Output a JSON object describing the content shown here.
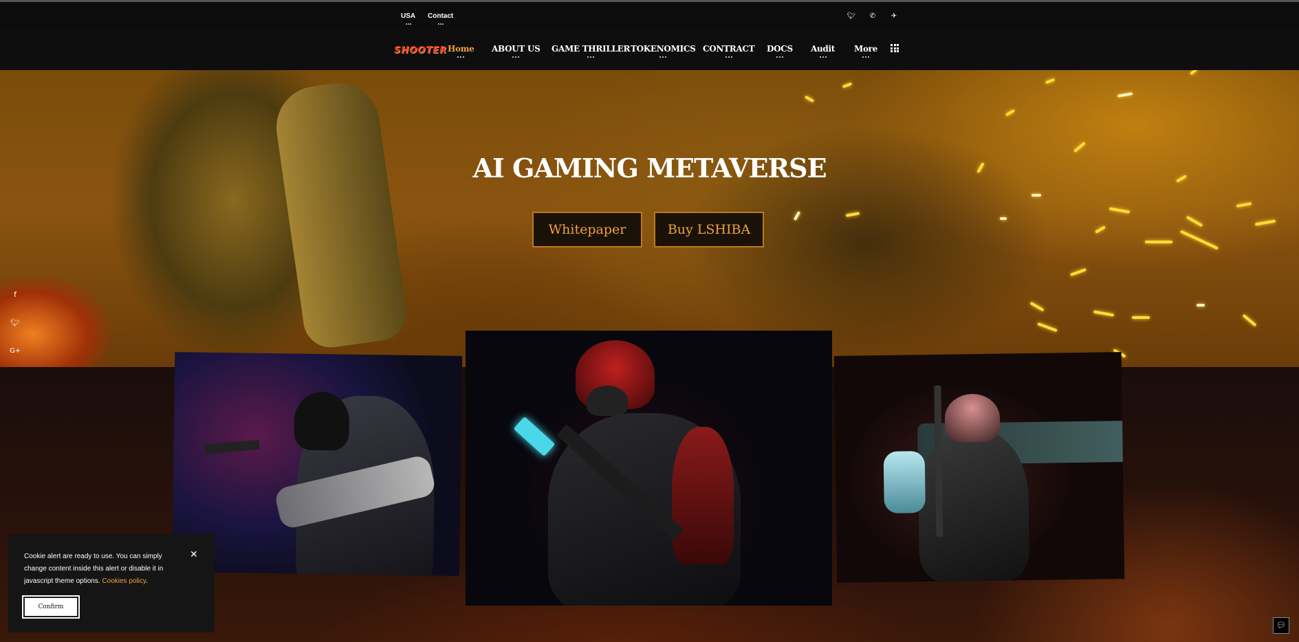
{
  "topbar": {
    "links": [
      "USA",
      "Contact"
    ],
    "social_icons": [
      "twitter-icon",
      "phone-icon",
      "telegram-icon"
    ]
  },
  "brand": {
    "logo_text": "SHOOTER"
  },
  "nav": {
    "items": [
      "Home",
      "ABOUT US",
      "GAME THRILLER",
      "TOKENOMICS",
      "CONTRACT",
      "DOCS",
      "Audit",
      "More"
    ],
    "active": "Home"
  },
  "hero": {
    "title": "AI GAMING METAVERSE",
    "buttons": [
      "Whitepaper",
      "Buy LSHIBA"
    ]
  },
  "side_social": [
    "facebook-icon",
    "twitter-icon",
    "google-plus-icon"
  ],
  "cookie": {
    "text": "Cookie alert are ready to use. You can simply change content inside this alert or disable it in javascript theme options.",
    "link": "Cookies policy",
    "link_suffix": ".",
    "confirm_label": "Confirm"
  },
  "colors": {
    "accent": "#f0a040",
    "button_border": "#c07820"
  }
}
